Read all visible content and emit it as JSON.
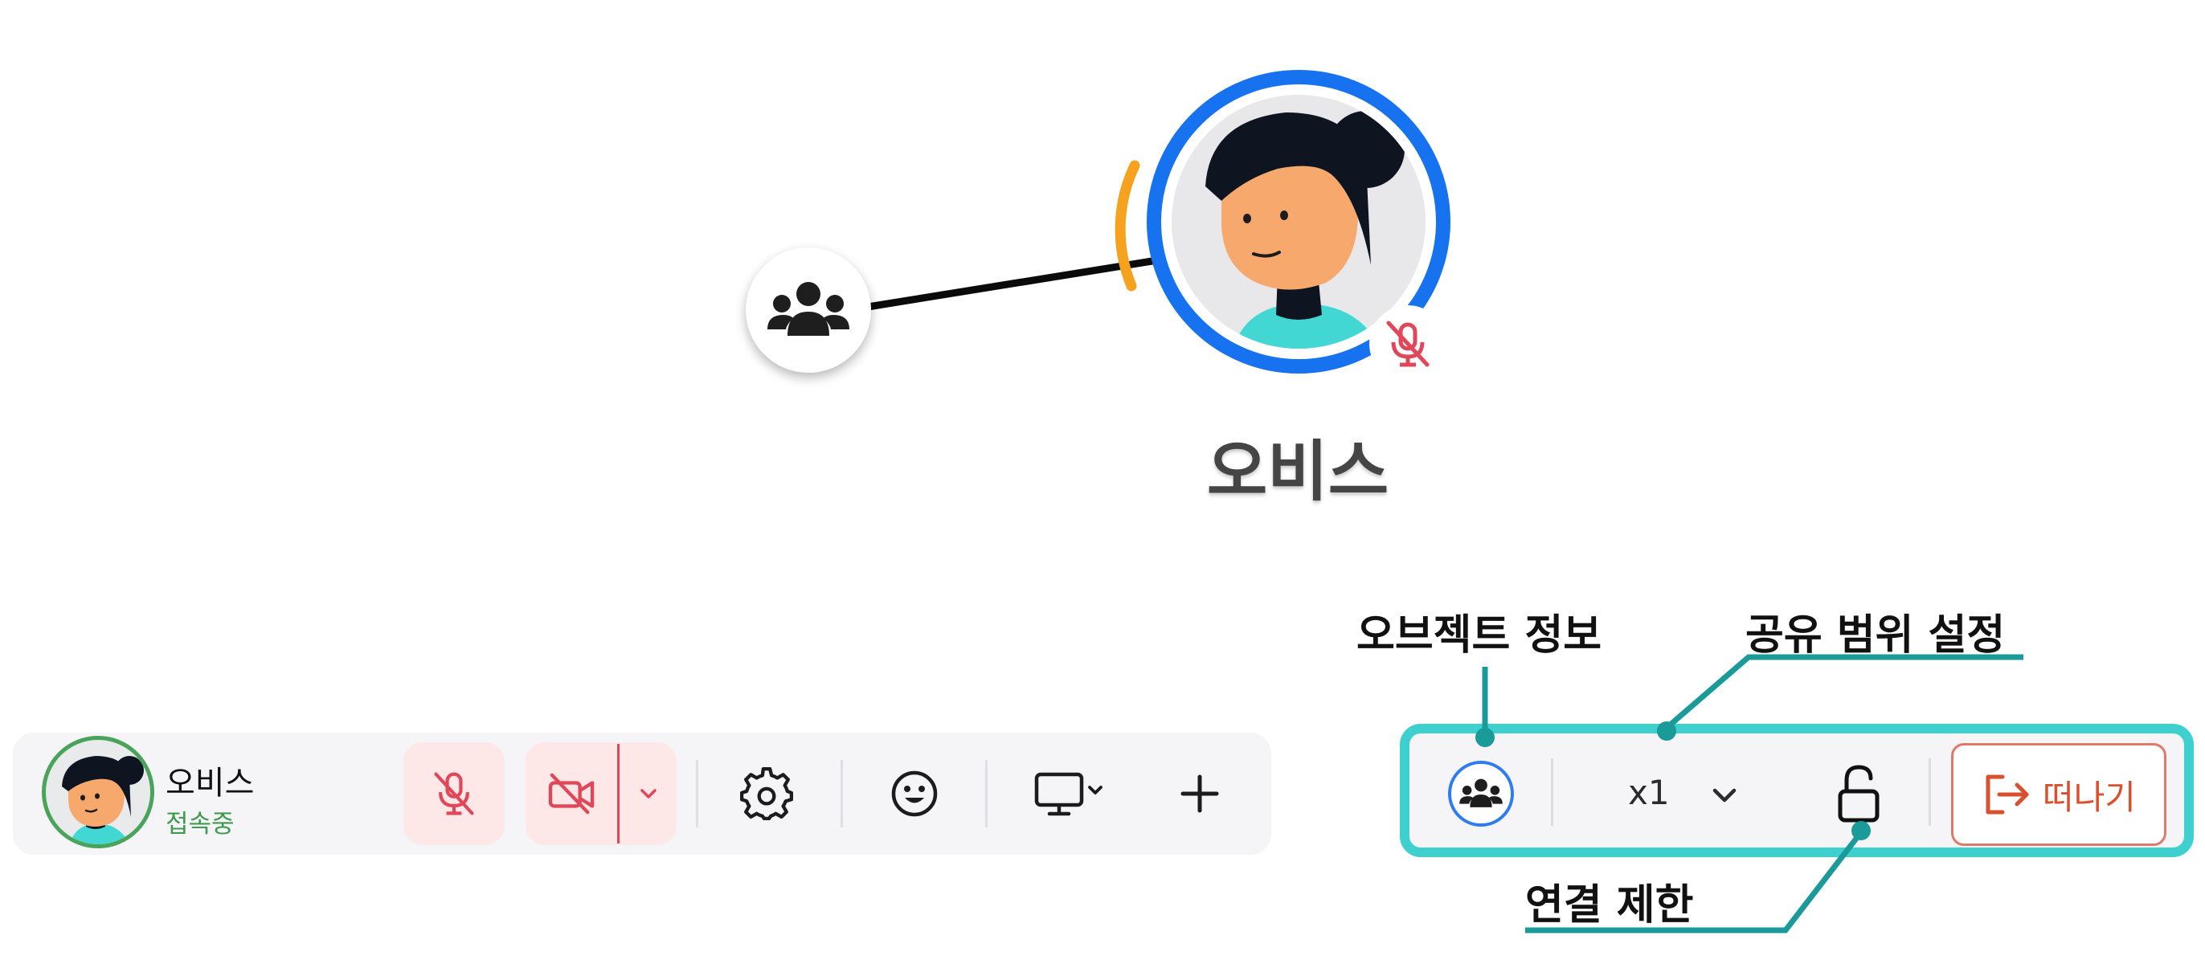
{
  "avatar_scene": {
    "user_name": "오비스",
    "group_icon": "users-group-icon",
    "mute_badge_icon": "mic-off-icon"
  },
  "toolbar": {
    "user_name": "오비스",
    "status": "접속중",
    "buttons": {
      "mic": "mic-off-icon",
      "camera": "camera-off-icon",
      "camera_menu": "chevron-down-icon",
      "settings": "gear-icon",
      "emoji": "smile-icon",
      "screen_share": "monitor-icon",
      "add": "plus-icon"
    }
  },
  "object_toolbar": {
    "object_info_icon": "users-group-icon",
    "zoom": "x1",
    "zoom_menu_icon": "chevron-down-icon",
    "lock_icon": "unlock-icon",
    "leave_label": "떠나기",
    "leave_icon": "exit-icon"
  },
  "annotations": {
    "object_info": "오브젝트 정보",
    "share_range": "공유 범위 설정",
    "connection_limit": "연결 제한"
  },
  "colors": {
    "accent_teal": "#3ecfcf",
    "callout_line": "#1a9a98",
    "ring_blue": "#1672ee",
    "speaking_orange": "#f6a21e",
    "danger_red": "#e0485a",
    "leave_red": "#d9502f",
    "online_green": "#3d9a4f"
  }
}
